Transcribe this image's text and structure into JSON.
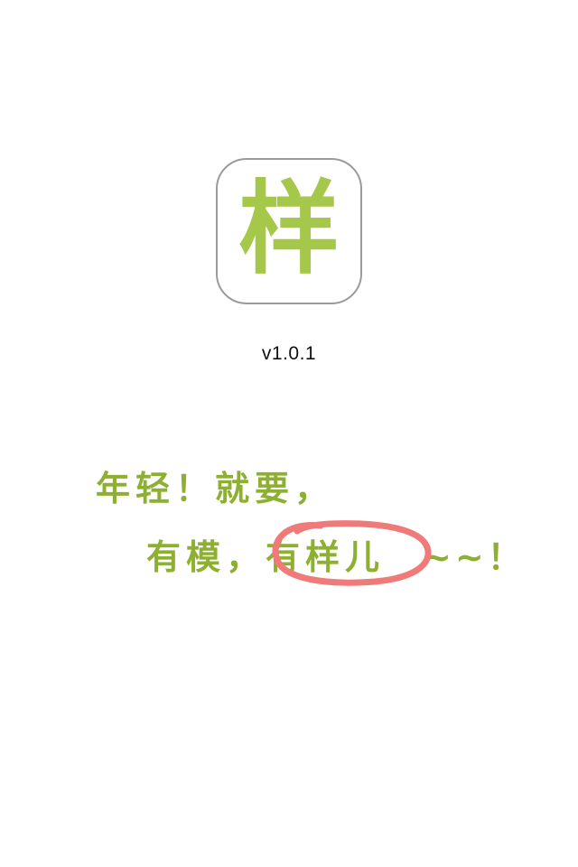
{
  "app": {
    "icon_glyph": "样",
    "icon_name": "app-logo-icon",
    "accent_color": "#a6c84a",
    "version": "v1.0.1"
  },
  "slogan": {
    "line1": "年轻！就要，",
    "line2_prefix": "有模，",
    "line2_highlight": "有样儿",
    "line2_suffix": "~~！",
    "text_color": "#8db030",
    "highlight_color": "#f07a7a"
  }
}
